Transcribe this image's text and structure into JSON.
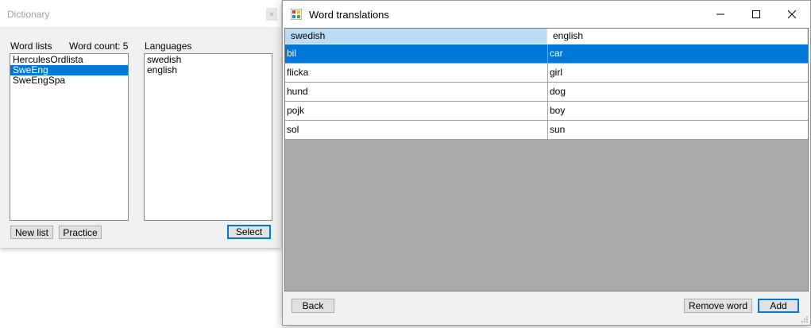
{
  "dictionary_window": {
    "title": "Dictionary",
    "word_lists_label": "Word lists",
    "word_count_label": "Word count: 5",
    "languages_label": "Languages",
    "word_lists": [
      "HerculesOrdlista",
      "SweEng",
      "SweEngSpa"
    ],
    "selected_list": "SweEng",
    "languages": [
      "swedish",
      "english"
    ],
    "buttons": {
      "new_list": "New list",
      "practice": "Practice",
      "select": "Select"
    }
  },
  "translations_window": {
    "title": "Word translations",
    "icon": "app-icon",
    "columns": [
      "swedish",
      "english"
    ],
    "rows": [
      [
        "bil",
        "car"
      ],
      [
        "flicka",
        "girl"
      ],
      [
        "hund",
        "dog"
      ],
      [
        "pojk",
        "boy"
      ],
      [
        "sol",
        "sun"
      ]
    ],
    "selected_row": 0,
    "buttons": {
      "back": "Back",
      "remove_word": "Remove word",
      "add": "Add"
    }
  },
  "colors": {
    "selection": "#0078d7",
    "active_header": "#bcdcf4",
    "grid_background": "#ababab",
    "window_background": "#f0f0f0"
  }
}
